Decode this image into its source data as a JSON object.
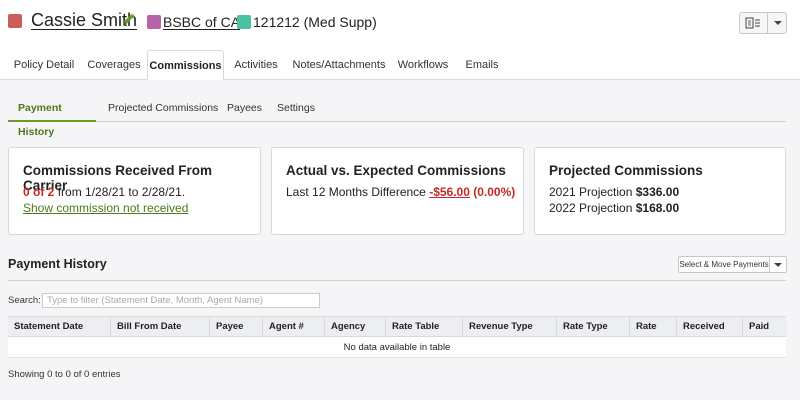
{
  "header": {
    "client_name": "Cassie Smith",
    "carrier": "BSBC of CA",
    "policy": "121212 (Med Supp)",
    "colors": {
      "client": "#cd5c5c",
      "carrier": "#b565a7",
      "policy": "#4cc1a4"
    }
  },
  "main_tabs": [
    {
      "label": "Policy Detail"
    },
    {
      "label": "Coverages"
    },
    {
      "label": "Commissions",
      "active": true
    },
    {
      "label": "Activities"
    },
    {
      "label": "Notes/Attachments"
    },
    {
      "label": "Workflows"
    },
    {
      "label": "Emails"
    }
  ],
  "sub_tabs": [
    {
      "label": "Payment History",
      "active": true
    },
    {
      "label": "Projected Commissions"
    },
    {
      "label": "Payees"
    },
    {
      "label": "Settings"
    }
  ],
  "cards": {
    "received": {
      "title": "Commissions Received From Carrier",
      "count": "0 of 2",
      "range_text": "from 1/28/21 to 2/28/21.",
      "link": "Show commission not received"
    },
    "actual": {
      "title": "Actual vs. Expected Commissions",
      "label": "Last 12 Months Difference",
      "amount": "-$56.00",
      "percent": "(0.00%)"
    },
    "projected": {
      "title": "Projected Commissions",
      "row1_label": "2021 Projection",
      "row1_value": "$336.00",
      "row2_label": "2022 Projection",
      "row2_value": "$168.00"
    }
  },
  "payment_history": {
    "title": "Payment History",
    "select_move_label": "Select & Move Payments",
    "search_label": "Search:",
    "search_placeholder": "Type to filter (Statement Date, Month, Agent Name)",
    "columns": [
      "Statement Date",
      "Bill From Date",
      "Payee",
      "Agent #",
      "Agency",
      "Rate Table",
      "Revenue Type",
      "Rate Type",
      "Rate",
      "Received",
      "Paid"
    ],
    "empty_text": "No data available in table",
    "footer": "Showing 0 to 0 of 0 entries"
  }
}
